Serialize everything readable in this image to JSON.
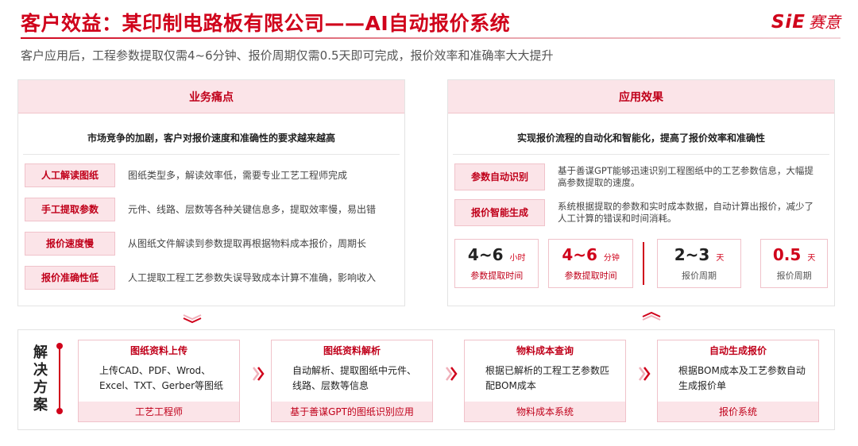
{
  "header": {
    "title": "客户效益：某印制电路板有限公司——AI自动报价系统",
    "logo_mark": "SiE",
    "logo_text": "赛意",
    "subtitle": "客户应用后，工程参数提取仅需4~6分钟、报价周期仅需0.5天即可完成，报价效率和准确率大大提升"
  },
  "pain": {
    "heading": "业务痛点",
    "description": "市场竞争的加剧，客户对报价速度和准确性的要求越来越高",
    "items": [
      {
        "tag": "人工解读图纸",
        "text": "图纸类型多，解读效率低，需要专业工艺工程师完成"
      },
      {
        "tag": "手工提取参数",
        "text": "元件、线路、层数等各种关键信息多，提取效率慢，易出错"
      },
      {
        "tag": "报价速度慢",
        "text": "从图纸文件解读到参数提取再根据物料成本报价，周期长"
      },
      {
        "tag": "报价准确性低",
        "text": "人工提取工程工艺参数失误导致成本计算不准确，影响收入"
      }
    ]
  },
  "effect": {
    "heading": "应用效果",
    "description": "实现报价流程的自动化和智能化，提高了报价效率和准确性",
    "items": [
      {
        "tag": "参数自动识别",
        "text": "基于善谋GPT能够迅速识别工程图纸中的工艺参数信息，大幅提高参数提取的速度。"
      },
      {
        "tag": "报价智能生成",
        "text": "系统根据提取的参数和实时成本数据，自动计算出报价，减少了人工计算的错误和时间消耗。"
      }
    ],
    "metrics": [
      {
        "value": "4~6",
        "unit": "小时",
        "label": "参数提取时间"
      },
      {
        "value": "4~6",
        "unit": "分钟",
        "label": "参数提取时间"
      },
      {
        "value": "2~3",
        "unit": "天",
        "label": "报价周期"
      },
      {
        "value": "0.5",
        "unit": "天",
        "label": "报价周期"
      }
    ]
  },
  "solution": {
    "label_chars": [
      "解",
      "决",
      "方",
      "案"
    ],
    "steps": [
      {
        "title": "图纸资料上传",
        "body": "上传CAD、PDF、Wrod、Excel、TXT、Gerber等图纸",
        "footer": "工艺工程师"
      },
      {
        "title": "图纸资料解析",
        "body": "自动解析、提取图纸中元件、线路、层数等信息",
        "footer": "基于善谋GPT的图纸识别应用"
      },
      {
        "title": "物料成本查询",
        "body": "根据已解析的工程工艺参数匹配BOM成本",
        "footer": "物料成本系统"
      },
      {
        "title": "自动生成报价",
        "body": "根据BOM成本及工艺参数自动生成报价单",
        "footer": "报价系统"
      }
    ]
  },
  "colors": {
    "brand": "#d0021b",
    "tag_bg": "#fbe4e8",
    "tag_border": "#f0c2ca"
  }
}
